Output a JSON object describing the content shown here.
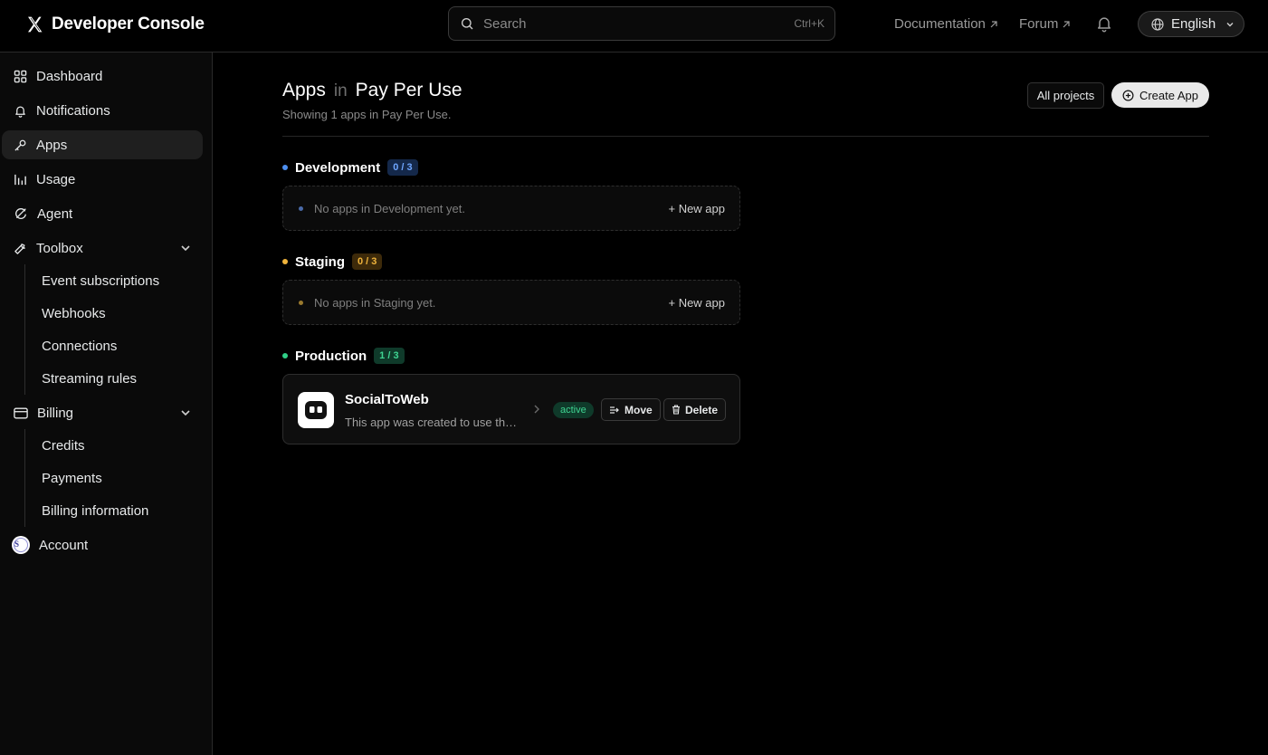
{
  "header": {
    "brand": "Developer Console",
    "search_placeholder": "Search",
    "search_shortcut": "Ctrl+K",
    "documentation": "Documentation",
    "forum": "Forum",
    "language": "English"
  },
  "sidebar": {
    "dashboard": "Dashboard",
    "notifications": "Notifications",
    "apps": "Apps",
    "usage": "Usage",
    "agent": "Agent",
    "toolbox": {
      "label": "Toolbox",
      "items": [
        "Event subscriptions",
        "Webhooks",
        "Connections",
        "Streaming rules"
      ]
    },
    "billing": {
      "label": "Billing",
      "items": [
        "Credits",
        "Payments",
        "Billing information"
      ]
    },
    "account": "Account"
  },
  "page": {
    "title": "Apps",
    "title_in": "in",
    "project": "Pay Per Use",
    "subtitle": "Showing 1 apps in Pay Per Use.",
    "all_projects": "All projects",
    "create_app": "Create App"
  },
  "sections": [
    {
      "name": "Development",
      "count": "0 / 3",
      "empty": "No apps in Development yet.",
      "new_app": "+ New app",
      "color": "#4d8ff0"
    },
    {
      "name": "Staging",
      "count": "0 / 3",
      "empty": "No apps in Staging yet.",
      "new_app": "+ New app",
      "color": "#f0b43c"
    },
    {
      "name": "Production",
      "count": "1 / 3",
      "color": "#2fcf87"
    }
  ],
  "app": {
    "name": "SocialToWeb",
    "description": "This app was created to use the…",
    "status": "active",
    "move": "Move",
    "delete": "Delete"
  },
  "colors": {
    "background": "#000000",
    "active_badge_bg": "#0f3a2a",
    "active_badge_text": "#3fd492"
  }
}
